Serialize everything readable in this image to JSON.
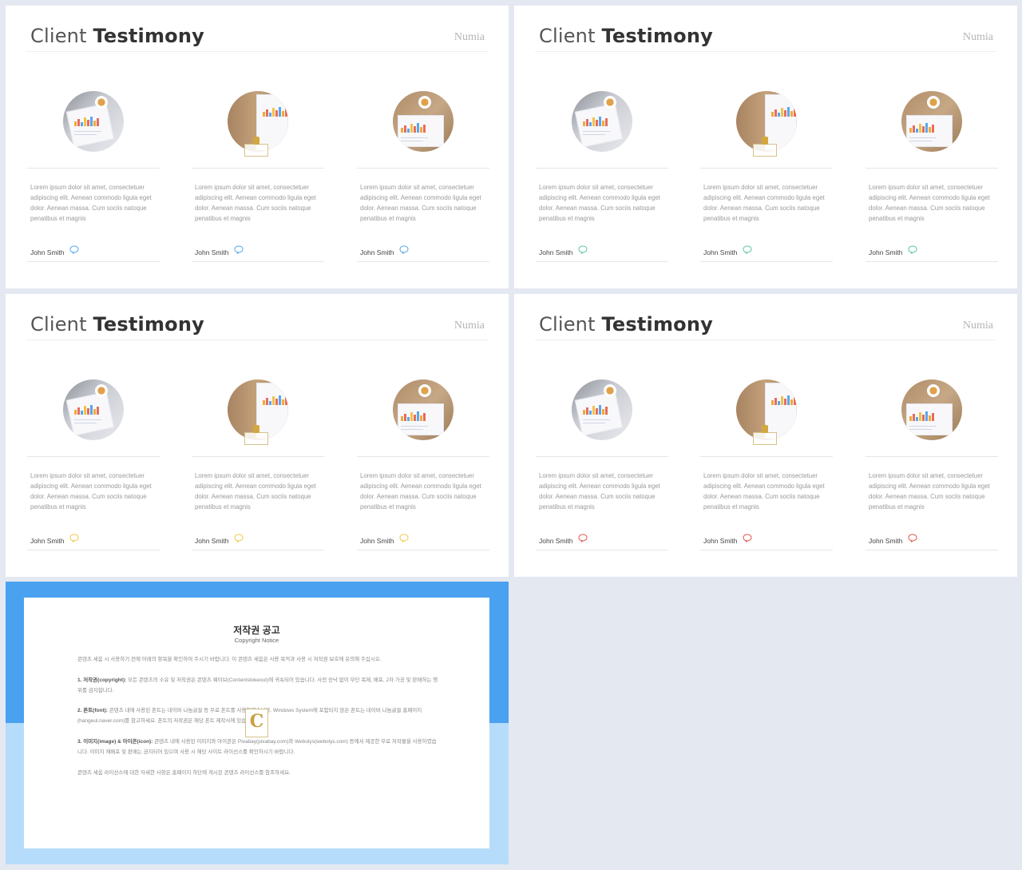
{
  "slides": [
    {
      "title_light": "Client",
      "title_bold": "Testimony",
      "brand": "Numia",
      "accent": "#59a8e8",
      "cards": [
        {
          "text": "Lorem ipsum dolor sit amet, consectetuer adipiscing elit. Aenean commodo ligula eget dolor. Aenean massa. Cum sociis natoque penatibus et magnis",
          "author": "John Smith"
        },
        {
          "text": "Lorem ipsum dolor sit amet, consectetuer adipiscing elit. Aenean commodo ligula eget dolor. Aenean massa. Cum sociis natoque penatibus et magnis",
          "author": "John Smith"
        },
        {
          "text": "Lorem ipsum dolor sit amet, consectetuer adipiscing elit. Aenean commodo ligula eget dolor. Aenean massa. Cum sociis natoque penatibus et magnis",
          "author": "John Smith"
        }
      ]
    },
    {
      "title_light": "Client",
      "title_bold": "Testimony",
      "brand": "Numia",
      "accent": "#5fc6a6",
      "cards": [
        {
          "text": "Lorem ipsum dolor sit amet, consectetuer adipiscing elit. Aenean commodo ligula eget dolor. Aenean massa. Cum sociis natoque penatibus et magnis",
          "author": "John Smith"
        },
        {
          "text": "Lorem ipsum dolor sit amet, consectetuer adipiscing elit. Aenean commodo ligula eget dolor. Aenean massa. Cum sociis natoque penatibus et magnis",
          "author": "John Smith"
        },
        {
          "text": "Lorem ipsum dolor sit amet, consectetuer adipiscing elit. Aenean commodo ligula eget dolor. Aenean massa. Cum sociis natoque penatibus et magnis",
          "author": "John Smith"
        }
      ]
    },
    {
      "title_light": "Client",
      "title_bold": "Testimony",
      "brand": "Numia",
      "accent": "#f1c94a",
      "cards": [
        {
          "text": "Lorem ipsum dolor sit amet, consectetuer adipiscing elit. Aenean commodo ligula eget dolor. Aenean massa. Cum sociis natoque penatibus et magnis",
          "author": "John Smith"
        },
        {
          "text": "Lorem ipsum dolor sit amet, consectetuer adipiscing elit. Aenean commodo ligula eget dolor. Aenean massa. Cum sociis natoque penatibus et magnis",
          "author": "John Smith"
        },
        {
          "text": "Lorem ipsum dolor sit amet, consectetuer adipiscing elit. Aenean commodo ligula eget dolor. Aenean massa. Cum sociis natoque penatibus et magnis",
          "author": "John Smith"
        }
      ]
    },
    {
      "title_light": "Client",
      "title_bold": "Testimony",
      "brand": "Numia",
      "accent": "#e05a4f",
      "cards": [
        {
          "text": "Lorem ipsum dolor sit amet, consectetuer adipiscing elit. Aenean commodo ligula eget dolor. Aenean massa. Cum sociis natoque penatibus et magnis",
          "author": "John Smith"
        },
        {
          "text": "Lorem ipsum dolor sit amet, consectetuer adipiscing elit. Aenean commodo ligula eget dolor. Aenean massa. Cum sociis natoque penatibus et magnis",
          "author": "John Smith"
        },
        {
          "text": "Lorem ipsum dolor sit amet, consectetuer adipiscing elit. Aenean commodo ligula eget dolor. Aenean massa. Cum sociis natoque penatibus et magnis",
          "author": "John Smith"
        }
      ]
    }
  ],
  "notice": {
    "title": "저작권 공고",
    "subtitle": "Copyright Notice",
    "logo_letter": "C",
    "paragraphs": [
      {
        "heading": "",
        "text": "콘텐츠 세움 시 사용하기 전에 아래의 항목을 확인하여 주시기 바랍니다. 이 콘텐츠 세움은 사용 목적과 사용 시 저작권 보호에 유의해 주십시오."
      },
      {
        "heading": "1. 저작권(copyright):",
        "text": "모든 콘텐츠의 소유 및 저작권은 콘텐츠 웨이브(Contentstokeout)에 귀속되어 있습니다. 사전 승낙 없이 무단 복제, 배포, 2차 가공 및 판매하는 행위를 금지합니다."
      },
      {
        "heading": "2. 폰트(font):",
        "text": "콘텐츠 내에 사용된 폰트는 네이버 나눔글꼴 등 무료 폰트를 사용하였습니다. Windows System에 포함되지 않은 폰트는 네이버 나눔글꼴 홈페이지(hangeul.naver.com)를 참고하세요. 폰트의 저작권은 해당 폰트 제작사에 있습니다."
      },
      {
        "heading": "3. 이미지(image) & 아이콘(icon):",
        "text": "콘텐츠 내에 사용된 이미지와 아이콘은 Pixabay(pixabay.com)와 Webolys(webolys.com) 등에서 제공한 무료 저작물을 사용하였습니다. 이미지 재배포 및 판매는 금지되어 있으며 사용 시 해당 사이트 라이선스를 확인하시기 바랍니다."
      },
      {
        "heading": "",
        "text": "콘텐츠 세움 라이선스에 대한 자세한 사항은 홈페이지 하단에 게시된 콘텐츠 라이선스를 참조하세요."
      }
    ]
  }
}
